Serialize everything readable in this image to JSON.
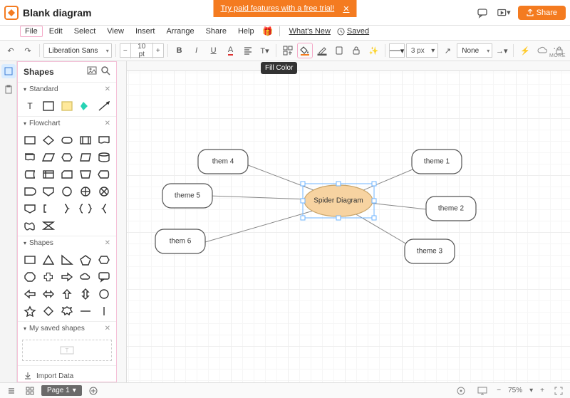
{
  "banner": {
    "text": "Try paid features with a free trial!",
    "close": "✕"
  },
  "doc_title": "Blank diagram",
  "menu": {
    "file": "File",
    "edit": "Edit",
    "select": "Select",
    "view": "View",
    "insert": "Insert",
    "arrange": "Arrange",
    "share": "Share",
    "help": "Help",
    "whatsnew": "What's New",
    "saved": "Saved"
  },
  "share_btn": "Share",
  "toolbar": {
    "font": "Liberation Sans",
    "font_size": "10 pt",
    "stroke_width": "3 px",
    "line_mode": "None",
    "tooltip": "Fill Color",
    "more": "MORE"
  },
  "sidepanel": {
    "title": "Shapes",
    "sections": {
      "standard": "Standard",
      "flowchart": "Flowchart",
      "shapes": "Shapes",
      "saved": "My saved shapes"
    },
    "import": "Import Data"
  },
  "diagram": {
    "center": "Spider Diagram",
    "nodes": {
      "t1": "theme 1",
      "t2": "theme 2",
      "t3": "theme 3",
      "t4": "them 4",
      "t5": "theme 5",
      "t6": "them 6"
    }
  },
  "bottom": {
    "page": "Page 1",
    "zoom": "75%"
  }
}
